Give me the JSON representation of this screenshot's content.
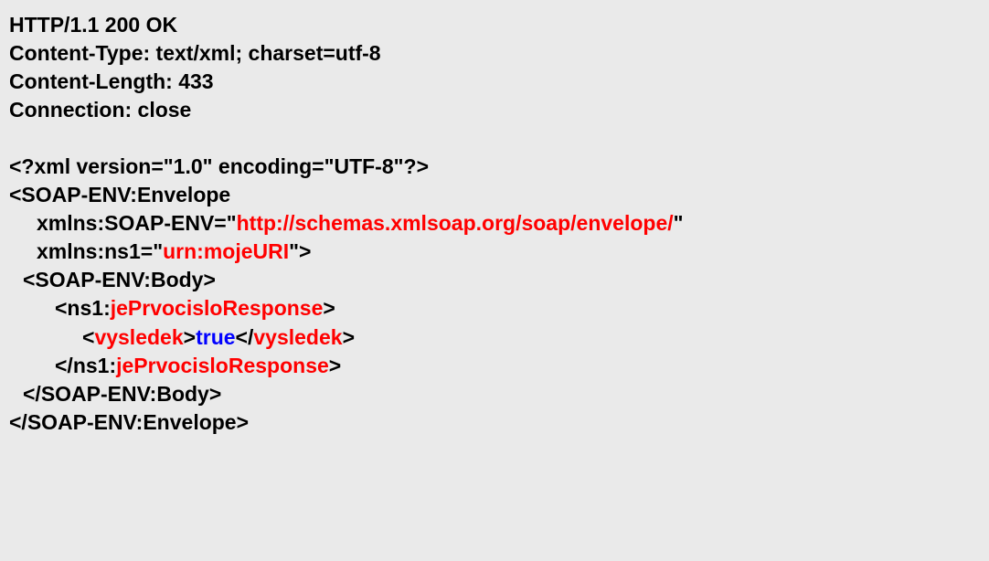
{
  "headers": {
    "status": "HTTP/1.1 200 OK",
    "contentType": "Content-Type: text/xml; charset=utf-8",
    "contentLength": "Content-Length: 433",
    "connection": "Connection: close"
  },
  "xml": {
    "declaration": "<?xml version=\"1.0\" encoding=\"UTF-8\"?>",
    "envelopeOpen": "<SOAP-ENV:Envelope",
    "xmlnsEnvPrefix": "xmlns:SOAP-ENV=\"",
    "xmlnsEnvValue": "http://schemas.xmlsoap.org/soap/envelope/",
    "xmlnsEnvSuffix": "\"",
    "xmlnsNs1Prefix": "xmlns:ns1=\"",
    "xmlnsNs1Value": "urn:mojeURI",
    "xmlnsNs1Suffix": "\">",
    "bodyOpen": "<SOAP-ENV:Body>",
    "responseOpen1": "<ns1:",
    "responseOpen2": "jePrvocisloResponse",
    "responseOpen3": ">",
    "resultOpen1": "<",
    "resultTag": "vysledek",
    "resultOpen2": ">",
    "resultValue": "true",
    "resultClose1": "</",
    "resultClose2": ">",
    "responseClose1": "</ns1:",
    "responseClose2": "jePrvocisloResponse",
    "responseClose3": ">",
    "bodyClose": "</SOAP-ENV:Body>",
    "envelopeClose": "</SOAP-ENV:Envelope>"
  }
}
